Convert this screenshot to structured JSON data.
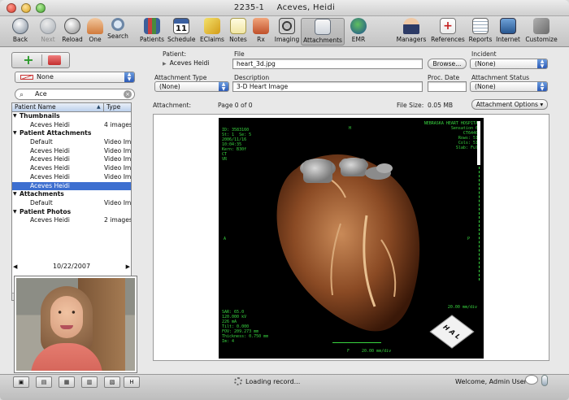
{
  "window": {
    "title_id": "2235-1",
    "title_name": "Aceves, Heidi"
  },
  "toolbar": {
    "back": "Back",
    "next": "Next",
    "reload": "Reload",
    "one": "One",
    "search": "Search",
    "patients": "Patients",
    "schedule": "Schedule",
    "schedule_day": "11",
    "eclaims": "EClaims",
    "notes": "Notes",
    "rx": "Rx",
    "imaging": "Imaging",
    "attachments": "Attachments",
    "emr": "EMR",
    "managers": "Managers",
    "references": "References",
    "reports": "Reports",
    "internet": "Internet",
    "customize": "Customize"
  },
  "sidebar": {
    "filter_value": "None",
    "search_value": "Ace",
    "columns": {
      "name": "Patient Name",
      "type": "Type"
    },
    "rows": [
      {
        "name": "Thumbnails",
        "type": "",
        "group": true
      },
      {
        "name": "Aceves Heidi",
        "type": "4 images"
      },
      {
        "name": "Patient Attachments",
        "type": "",
        "group": true
      },
      {
        "name": "Default",
        "type": "Video Im"
      },
      {
        "name": "Aceves Heidi",
        "type": "Video Im"
      },
      {
        "name": "Aceves Heidi",
        "type": "Video Im"
      },
      {
        "name": "Aceves Heidi",
        "type": "Video Im"
      },
      {
        "name": "Aceves Heidi",
        "type": "Video Im"
      },
      {
        "name": "Aceves Heidi",
        "type": "",
        "selected": true
      },
      {
        "name": "Attachments",
        "type": "",
        "group": true
      },
      {
        "name": "Default",
        "type": "Video Im"
      },
      {
        "name": "Patient Photos",
        "type": "",
        "group": true
      },
      {
        "name": "Aceves Heidi",
        "type": "2 images"
      }
    ],
    "date": "10/22/2007"
  },
  "form": {
    "patient_label": "Patient:",
    "patient_value": "Aceves Heidi",
    "file_label": "File",
    "file_value": "heart_3d.jpg",
    "browse": "Browse...",
    "incident_label": "Incident",
    "incident_value": "(None)",
    "attachment_type_label": "Attachment Type",
    "attachment_type_value": "(None)",
    "description_label": "Description",
    "description_value": "3-D Heart Image",
    "proc_date_label": "Proc. Date",
    "proc_date_value": "",
    "attachment_status_label": "Attachment Status",
    "attachment_status_value": "(None)",
    "attachment_label": "Attachment:",
    "page_info": "Page 0 of 0",
    "file_size_label": "File Size:",
    "file_size_value": "0.05 MB",
    "attachment_options": "Attachment Options"
  },
  "viewer": {
    "hospital": "NEBRASKA HEART HOSPITAL",
    "top_right_lines": "Sensation 64\nCT6440K\nRows: 512\nCols: 512\nSlab: Full",
    "top_left_lines": "ID: 3583160\nSt: 1  Se: 5\n2006/11/16\n10:04:35\nKern: B30f\nCT\nVR",
    "bottom_left_lines": "SAR: 65.0\n120.000 kV\n226 mA\nTilt: 0.000\nFOV: 209.273 mm\nThickness: 0.750 mm\nIm: 4",
    "scale_right": "20.00 mm/div",
    "scale_bottom": "20.00 mm/div",
    "marker_top": "H",
    "marker_left": "A",
    "marker_right": "P",
    "marker_bottom": "F",
    "cube_letters": "H A L"
  },
  "status": {
    "loading": "Loading record...",
    "welcome": "Welcome, Admin User"
  }
}
